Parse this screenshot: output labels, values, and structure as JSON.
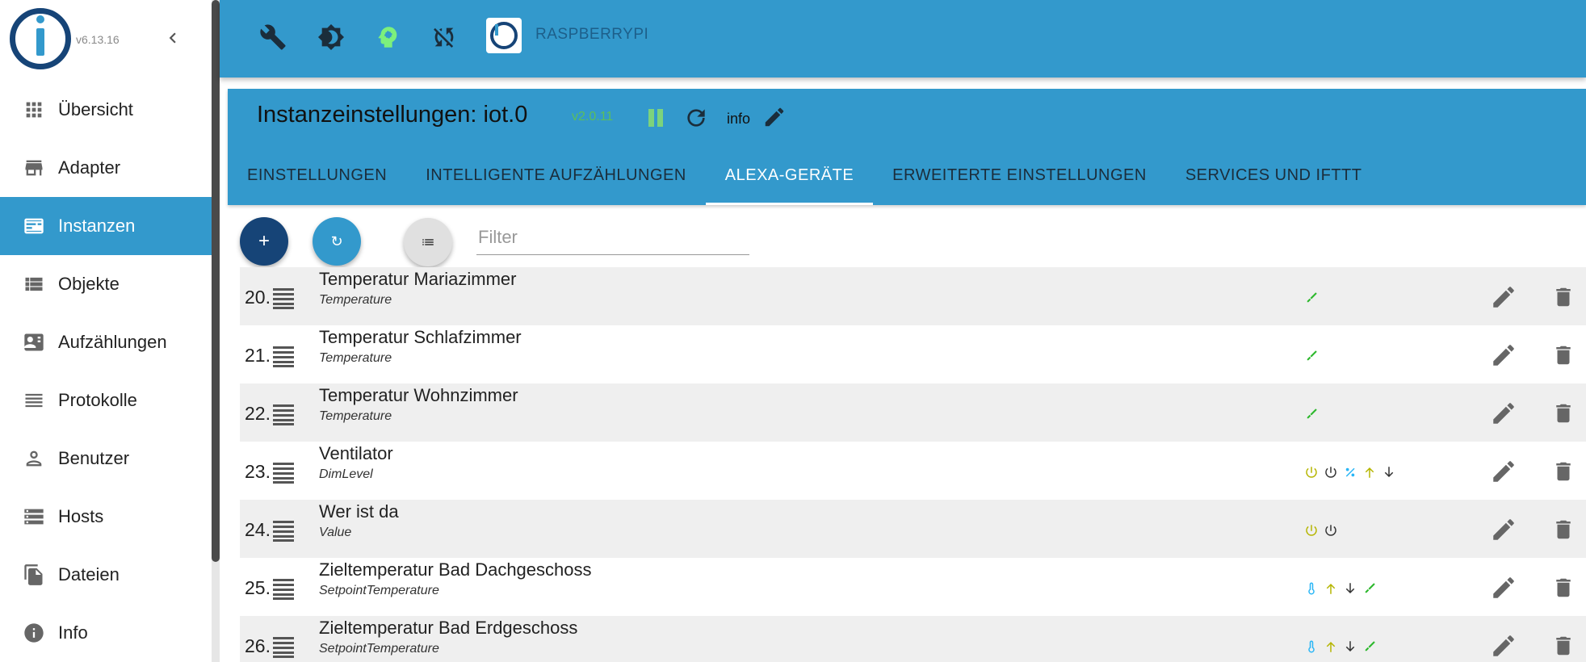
{
  "app": {
    "version": "v6.13.16",
    "host_name": "RASPBERRYPI"
  },
  "sidebar": {
    "items": [
      {
        "label": "Übersicht",
        "icon": "grid-icon"
      },
      {
        "label": "Adapter",
        "icon": "store-icon"
      },
      {
        "label": "Instanzen",
        "icon": "instances-icon",
        "active": true
      },
      {
        "label": "Objekte",
        "icon": "list-icon"
      },
      {
        "label": "Aufzählungen",
        "icon": "contact-card-icon"
      },
      {
        "label": "Protokolle",
        "icon": "lines-icon"
      },
      {
        "label": "Benutzer",
        "icon": "person-icon"
      },
      {
        "label": "Hosts",
        "icon": "storage-icon"
      },
      {
        "label": "Dateien",
        "icon": "files-icon"
      },
      {
        "label": "Info",
        "icon": "info-icon"
      }
    ]
  },
  "instance": {
    "title": "Instanzeinstellungen: iot.0",
    "version": "v2.0.11",
    "info_label": "info"
  },
  "tabs": [
    {
      "label": "EINSTELLUNGEN"
    },
    {
      "label": "INTELLIGENTE AUFZÄHLUNGEN"
    },
    {
      "label": "ALEXA-GERÄTE",
      "active": true
    },
    {
      "label": "ERWEITERTE EINSTELLUNGEN"
    },
    {
      "label": "SERVICES UND IFTTT"
    }
  ],
  "toolbar": {
    "add_label": "+",
    "refresh_label": "↻",
    "filter_placeholder": "Filter"
  },
  "colors": {
    "primary": "#3399cc",
    "dark_blue": "#164477",
    "cap_green": "#2db82d",
    "cap_olive": "#b5b500",
    "cap_cyan": "#29b6f6"
  },
  "devices": [
    {
      "index": "20.",
      "name": "Temperatur Mariazimmer",
      "type": "Temperature",
      "caps": [
        "thermometer"
      ]
    },
    {
      "index": "21.",
      "name": "Temperatur Schlafzimmer",
      "type": "Temperature",
      "caps": [
        "thermometer"
      ]
    },
    {
      "index": "22.",
      "name": "Temperatur Wohnzimmer",
      "type": "Temperature",
      "caps": [
        "thermometer"
      ]
    },
    {
      "index": "23.",
      "name": "Ventilator",
      "type": "DimLevel",
      "caps": [
        "power-on",
        "power-off",
        "percent",
        "up",
        "down"
      ]
    },
    {
      "index": "24.",
      "name": "Wer ist da",
      "type": "Value",
      "caps": [
        "power-on",
        "power-off"
      ]
    },
    {
      "index": "25.",
      "name": "Zieltemperatur Bad Dachgeschoss",
      "type": "SetpointTemperature",
      "caps": [
        "setpoint",
        "up",
        "down",
        "thermometer"
      ]
    },
    {
      "index": "26.",
      "name": "Zieltemperatur Bad Erdgeschoss",
      "type": "SetpointTemperature",
      "caps": [
        "setpoint",
        "up",
        "down",
        "thermometer"
      ]
    }
  ]
}
